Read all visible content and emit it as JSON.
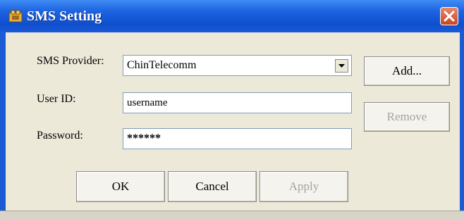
{
  "window": {
    "title": "SMS Setting"
  },
  "form": {
    "provider_label": "SMS Provider:",
    "provider_value": "ChinTelecomm",
    "userid_label": "User ID:",
    "userid_value": "username",
    "password_label": "Password:",
    "password_value": "******"
  },
  "buttons": {
    "add": "Add...",
    "remove": "Remove",
    "ok": "OK",
    "cancel": "Cancel",
    "apply": "Apply"
  },
  "icons": {
    "app": "sms-app-icon",
    "close": "close-icon",
    "dropdown": "chevron-down-icon"
  }
}
